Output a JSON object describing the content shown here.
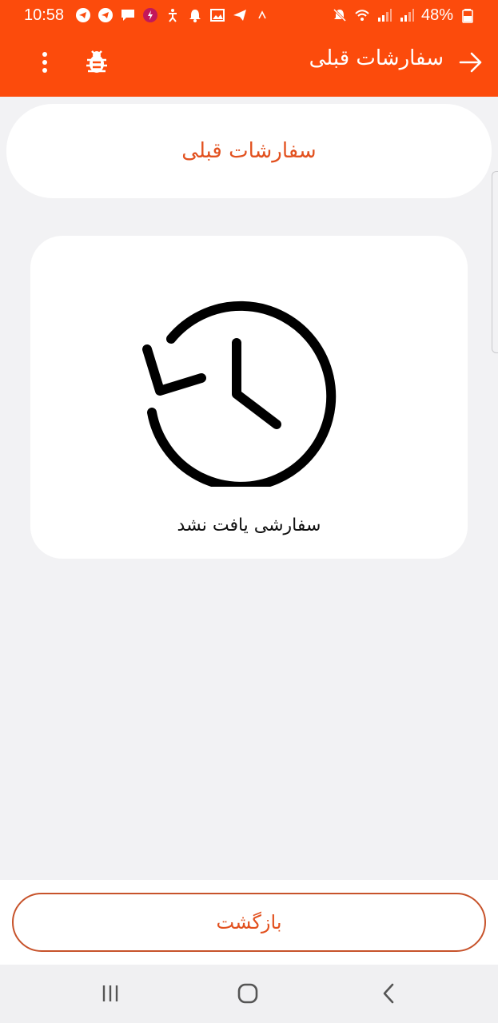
{
  "status_bar": {
    "time": "10:58",
    "battery": "48%",
    "icons_left": [
      "telegram-icon",
      "telegram-icon",
      "message-icon",
      "power-app-icon",
      "accessibility-icon",
      "bell-icon",
      "image-icon",
      "send-icon",
      "caret-up-icon"
    ],
    "icons_right": [
      "mute-icon",
      "wifi-icon",
      "signal-icon",
      "signal-icon",
      "battery-icon"
    ]
  },
  "app_bar": {
    "title": "سفارشات قبلی",
    "back_icon": "arrow-right-icon",
    "menu_icon": "more-vert-icon",
    "debug_icon": "bug-icon"
  },
  "header_card": {
    "title": "سفارشات قبلی"
  },
  "empty_state": {
    "icon": "history-icon",
    "message": "سفارشی یافت نشد"
  },
  "footer": {
    "back_label": "بازگشت"
  },
  "colors": {
    "primary": "#fc4b0c",
    "accent_text": "#e2511f",
    "background": "#f2f2f4",
    "card": "#ffffff"
  }
}
